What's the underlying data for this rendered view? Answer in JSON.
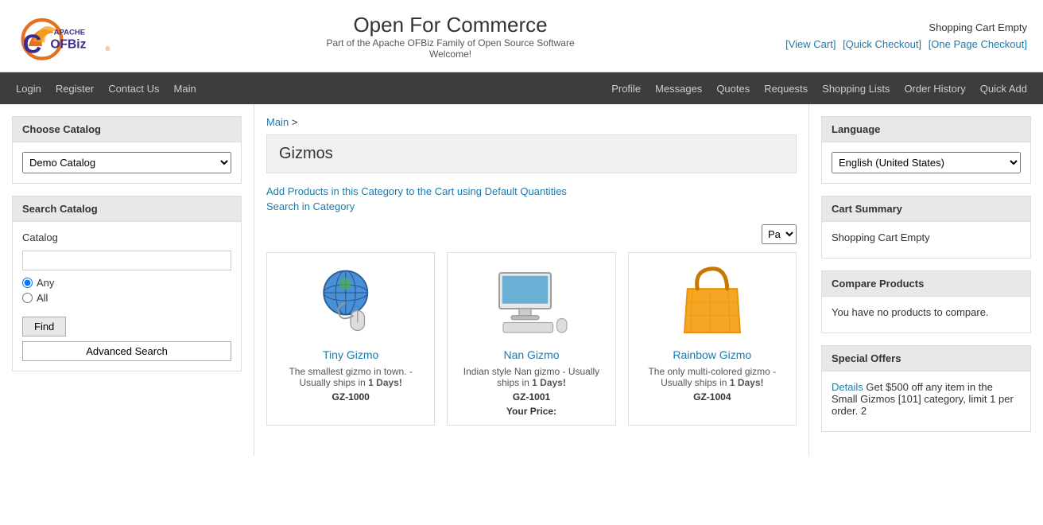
{
  "header": {
    "title": "Open For Commerce",
    "subtitle1": "Part of the Apache OFBiz Family of Open Source Software",
    "subtitle2": "Welcome!",
    "cart_status": "Shopping Cart Empty",
    "cart_links": [
      "[View Cart]",
      "[Quick Checkout]",
      "[One Page Checkout]"
    ]
  },
  "nav_left": [
    {
      "label": "Login",
      "name": "nav-login"
    },
    {
      "label": "Register",
      "name": "nav-register"
    },
    {
      "label": "Contact Us",
      "name": "nav-contact"
    },
    {
      "label": "Main",
      "name": "nav-main"
    }
  ],
  "nav_right": [
    {
      "label": "Profile",
      "name": "nav-profile"
    },
    {
      "label": "Messages",
      "name": "nav-messages"
    },
    {
      "label": "Quotes",
      "name": "nav-quotes"
    },
    {
      "label": "Requests",
      "name": "nav-requests"
    },
    {
      "label": "Shopping Lists",
      "name": "nav-shopping-lists"
    },
    {
      "label": "Order History",
      "name": "nav-order-history"
    },
    {
      "label": "Quick Add",
      "name": "nav-quick-add"
    }
  ],
  "sidebar": {
    "choose_catalog": {
      "title": "Choose Catalog",
      "options": [
        "Demo Catalog"
      ],
      "selected": "Demo Catalog"
    },
    "search_catalog": {
      "title": "Search Catalog",
      "catalog_label": "Catalog",
      "catalog_placeholder": "",
      "radio_any": "Any",
      "radio_all": "All",
      "find_button": "Find",
      "advanced_button": "Advanced Search"
    }
  },
  "breadcrumb": {
    "main": "Main",
    "separator": ">"
  },
  "category": {
    "name": "Gizmos",
    "links": [
      "Add Products in this Category to the Cart using Default Quantities",
      "Search in Category"
    ]
  },
  "pagination": {
    "label": "Pa",
    "options": [
      "Pa"
    ]
  },
  "products": [
    {
      "id": "GZ-1000",
      "name": "Tiny Gizmo",
      "description": "The smallest gizmo in town. - Usually ships in 1 Days!",
      "bold_part": "1 Days!",
      "price_label": ""
    },
    {
      "id": "GZ-1001",
      "name": "Nan Gizmo",
      "description": "Indian style Nan gizmo - Usually ships in 1 Days!",
      "bold_part": "1 Days!",
      "price_label": "Your Price:"
    },
    {
      "id": "GZ-1004",
      "name": "Rainbow Gizmo",
      "description": "The only multi-colored gizmo - Usually ships in 1 Days!",
      "bold_part": "1 Days!",
      "price_label": ""
    }
  ],
  "right_panel": {
    "language": {
      "title": "Language",
      "options": [
        "English (United States)"
      ],
      "selected": "English (United States)"
    },
    "cart_summary": {
      "title": "Cart Summary",
      "status": "Shopping Cart Empty"
    },
    "compare": {
      "title": "Compare Products",
      "message": "You have no products to compare."
    },
    "special_offers": {
      "title": "Special Offers",
      "text": "Details",
      "description": "Get $500 off any item in the Small Gizmos [101] category, limit 1 per order. 2"
    }
  }
}
